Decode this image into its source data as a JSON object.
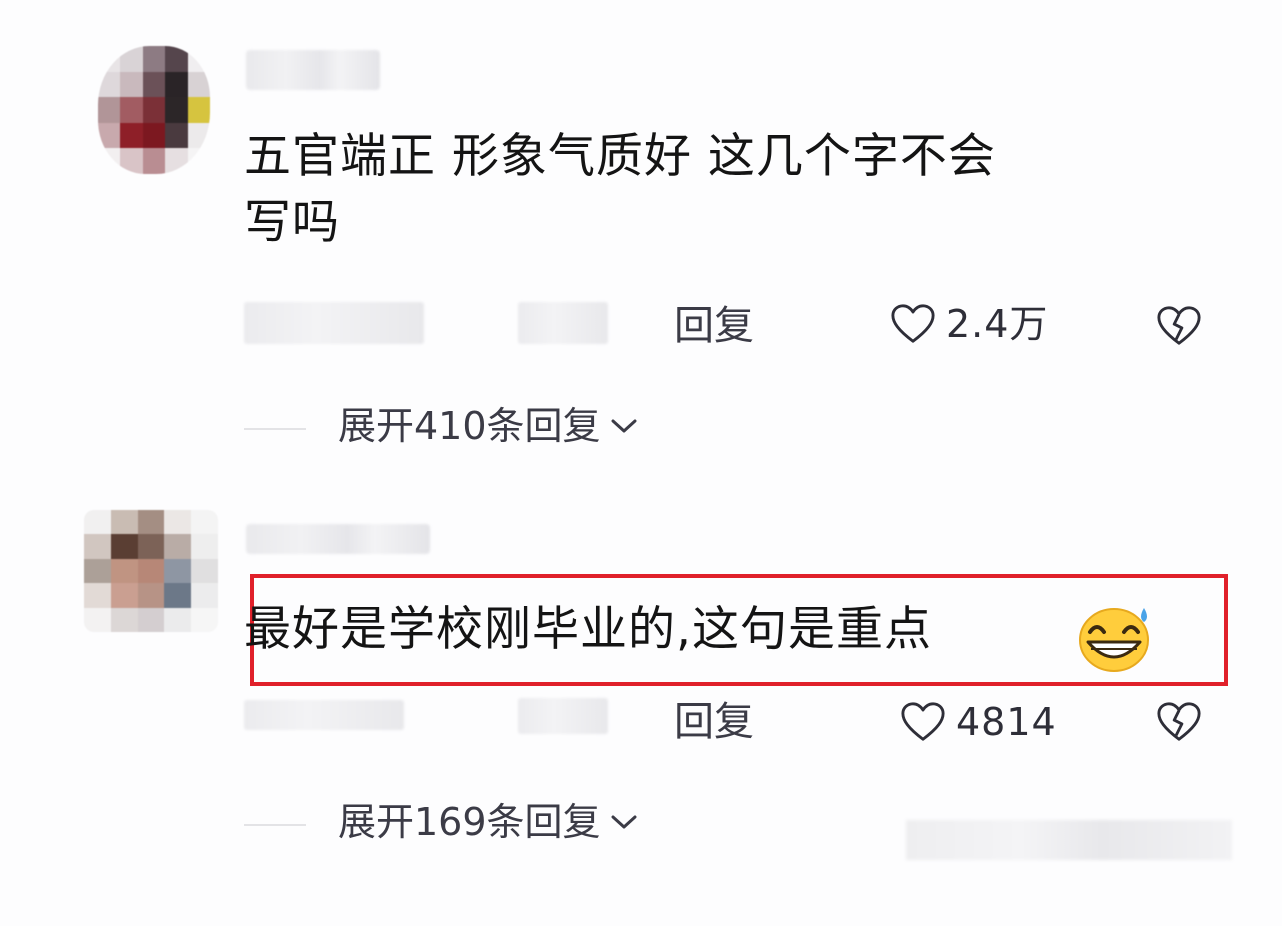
{
  "comments": [
    {
      "text_line1": "五官端正  形象气质好  这几个字不会",
      "text_line2": "写吗",
      "reply_label": "回复",
      "like_count": "2.4万",
      "expand_label": "展开410条回复"
    },
    {
      "text": "最好是学校刚毕业的,这句是重点",
      "emoji": "grinning-face-with-sweat",
      "reply_label": "回复",
      "like_count": "4814",
      "expand_label": "展开169条回复",
      "highlighted": true,
      "highlight_color": "#e0202a"
    }
  ],
  "icons": {
    "like": "heart-outline-icon",
    "dislike": "broken-heart-icon",
    "expand": "chevron-down-icon"
  }
}
